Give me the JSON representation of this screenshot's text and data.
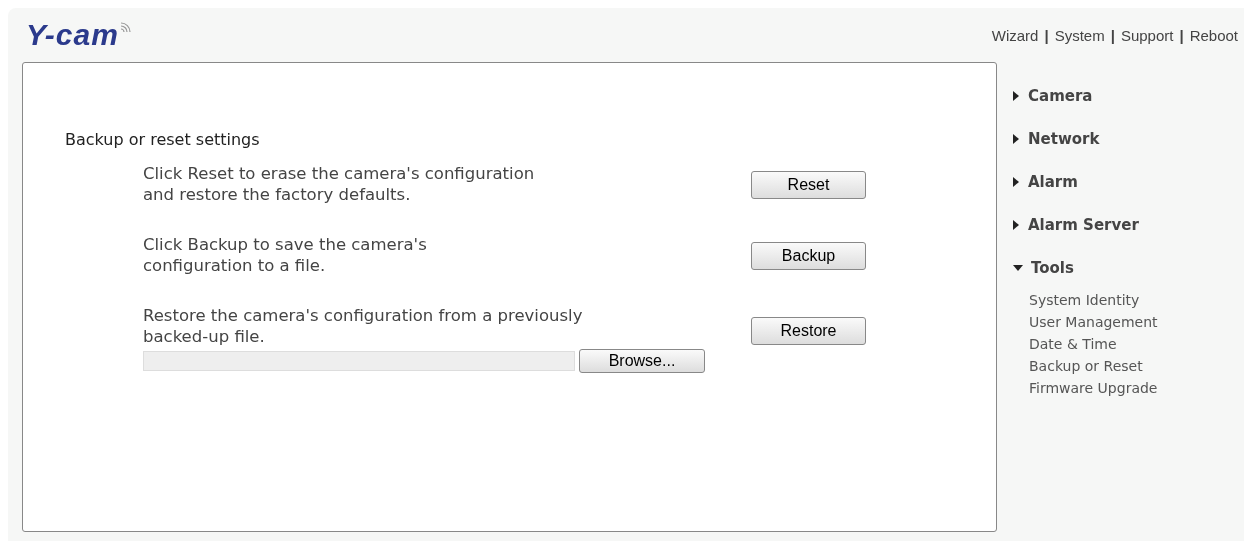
{
  "logo": {
    "text": "Y-cam"
  },
  "top_links": [
    {
      "kind": "link",
      "text": "Wizard"
    },
    {
      "kind": "separator",
      "text": "|"
    },
    {
      "kind": "link",
      "text": "System"
    },
    {
      "kind": "separator",
      "text": "|"
    },
    {
      "kind": "link",
      "text": "Support"
    },
    {
      "kind": "separator",
      "text": "|"
    },
    {
      "kind": "link",
      "text": "Reboot"
    }
  ],
  "panel": {
    "title": "Backup or reset settings",
    "rows": [
      {
        "kind": "action",
        "text": "Click Reset to erase the camera's configuration\nand restore the factory defaults.",
        "button": "Reset"
      },
      {
        "kind": "action",
        "text": "Click Backup to save the camera's\nconfiguration to a file.",
        "button": "Backup"
      },
      {
        "kind": "file",
        "text": "Restore the camera's configuration from a previously\nbacked-up file.",
        "browse": "Browse...",
        "button": "Restore"
      }
    ]
  },
  "sidebar": {
    "items": [
      {
        "label": "Camera",
        "expanded": false
      },
      {
        "label": "Network",
        "expanded": false
      },
      {
        "label": "Alarm",
        "expanded": false
      },
      {
        "label": "Alarm Server",
        "expanded": false
      },
      {
        "label": "Tools",
        "expanded": true,
        "children": [
          {
            "label": "System Identity"
          },
          {
            "label": "User Management"
          },
          {
            "label": "Date & Time"
          },
          {
            "label": "Backup or Reset"
          },
          {
            "label": "Firmware Upgrade"
          }
        ]
      }
    ]
  }
}
